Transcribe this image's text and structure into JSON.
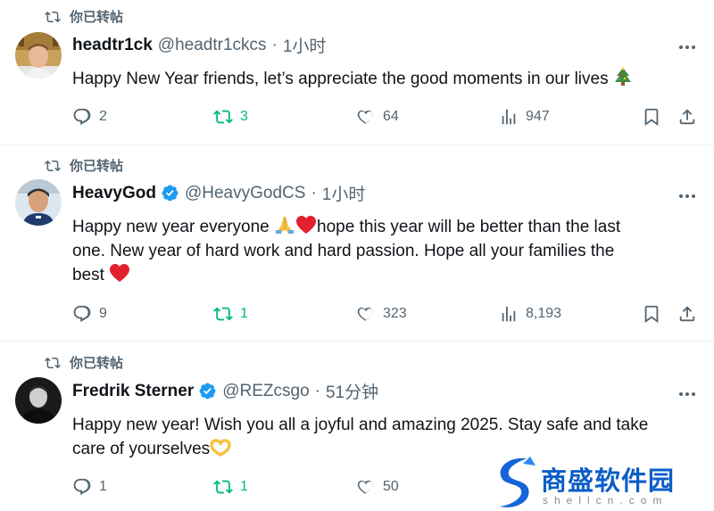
{
  "tweets": [
    {
      "repost_label": "你已转帖",
      "name": "headtr1ck",
      "verified": false,
      "handle": "@headtr1ckcs",
      "dot": "·",
      "time": "1小时",
      "lines": [
        "Happy New Year friends, let’s appreciate the good moments in our lives"
      ],
      "emoji": "christmas-tree",
      "replies": "2",
      "reposts": "3",
      "likes": "64",
      "views": "947"
    },
    {
      "repost_label": "你已转帖",
      "name": "HeavyGod",
      "verified": true,
      "handle": "@HeavyGodCS",
      "dot": "·",
      "time": "1小时",
      "lines": [
        "Happy new year everyone",
        "hope this year will be better than the last",
        "one.  New year of hard work and hard passion. Hope all your families the",
        "best"
      ],
      "replies": "9",
      "reposts": "1",
      "likes": "323",
      "views": "8,193"
    },
    {
      "repost_label": "你已转帖",
      "name": "Fredrik Sterner",
      "verified": true,
      "handle": "@REZcsgo",
      "dot": "·",
      "time": "51分钟",
      "lines": [
        "Happy new year! Wish you all a joyful and amazing 2025. Stay safe and take",
        "care of yourselves"
      ],
      "replies": "1",
      "reposts": "1",
      "likes": "50"
    }
  ],
  "watermark": {
    "title": "商盛软件园",
    "subtitle": "shellcn.com"
  },
  "colors": {
    "text": "#0f1419",
    "muted": "#536471",
    "repost_green": "#00ba7c",
    "verified_blue": "#1d9bf0",
    "divider": "#eff3f4"
  }
}
